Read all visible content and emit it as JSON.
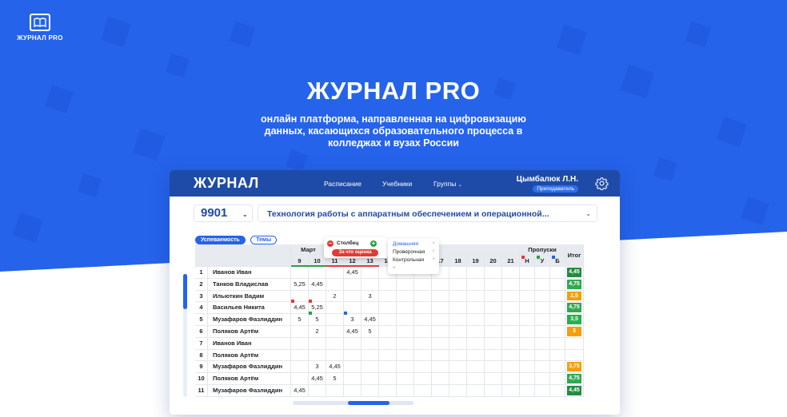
{
  "brand": {
    "logo_text": "ЖУРНАЛ PRO",
    "title": "ЖУРНАЛ PRO",
    "subtitle": "онлайн платформа, направленная на цифровизацию данных, касающихся образовательного процесса в колледжах и вузах России"
  },
  "app": {
    "brand": "ЖУРНАЛ",
    "nav": [
      "Расписание",
      "Учебники",
      "Группы"
    ],
    "user_name": "Цымбалюк Л.Н.",
    "user_role": "Преподаватель",
    "group": "9901",
    "subject": "Технология работы с аппаратным обеспечением и операционной...",
    "tabs": [
      "Успеваемость",
      "Темы"
    ],
    "month": "Март",
    "days": [
      "9",
      "10",
      "11",
      "12",
      "13",
      "14",
      "15",
      "16",
      "17",
      "18",
      "19",
      "20",
      "21"
    ],
    "absences_header": "Пропуски",
    "absence_cols": [
      "Н",
      "У",
      "Б"
    ],
    "itog_header": "Итог",
    "popover": {
      "label": "Столбец",
      "button": "За что оценка"
    },
    "dropdown": [
      "Домашняя",
      "Проверочная",
      "Контрольная",
      "+"
    ],
    "rows": [
      {
        "n": "1",
        "name": "Иванов Иван",
        "marks": [
          "",
          "",
          "",
          "4,45",
          "",
          "",
          "",
          "",
          "",
          "",
          "",
          "",
          ""
        ],
        "itog": "4,45",
        "itog_color": "#1e8e3e"
      },
      {
        "n": "2",
        "name": "Танков Владислав",
        "marks": [
          "5,25",
          "4,45",
          "",
          "",
          "",
          "",
          "",
          "",
          "",
          "",
          "",
          "",
          ""
        ],
        "itog": "4,75",
        "itog_color": "#34a853"
      },
      {
        "n": "3",
        "name": "Ильюткин Вадим",
        "marks": [
          "",
          "",
          "2",
          "",
          "3",
          "",
          "",
          "",
          "",
          "",
          "",
          "",
          ""
        ],
        "itog": "2,5",
        "itog_color": "#f59e0b"
      },
      {
        "n": "4",
        "name": "Васильев Никита",
        "marks": [
          "4,45",
          "5,25",
          "",
          "",
          "",
          "",
          "",
          "",
          "",
          "",
          "",
          "",
          ""
        ],
        "itog": "4,75",
        "itog_color": "#34a853"
      },
      {
        "n": "5",
        "name": "Музафаров Фазлиддин",
        "marks": [
          "5",
          "5",
          "",
          "3",
          "4,45",
          "",
          "",
          "",
          "",
          "",
          "",
          "",
          ""
        ],
        "itog": "3,5",
        "itog_color": "#22b14c"
      },
      {
        "n": "6",
        "name": "Поляков Артём",
        "marks": [
          "",
          "2",
          "",
          "4,45",
          "5",
          "",
          "",
          "",
          "",
          "",
          "",
          "",
          ""
        ],
        "itog": "3",
        "itog_color": "#f59e0b"
      },
      {
        "n": "7",
        "name": "Иванов Иван",
        "marks": [
          "",
          "",
          "",
          "",
          "",
          "",
          "",
          "",
          "",
          "",
          "",
          "",
          ""
        ],
        "itog": "",
        "itog_color": ""
      },
      {
        "n": "8",
        "name": "Поляков Артём",
        "marks": [
          "",
          "",
          "",
          "",
          "",
          "",
          "",
          "",
          "",
          "",
          "",
          "",
          ""
        ],
        "itog": "",
        "itog_color": ""
      },
      {
        "n": "9",
        "name": "Музафаров Фазлиддин",
        "marks": [
          "",
          "3",
          "4,45",
          "",
          "",
          "",
          "",
          "",
          "",
          "",
          "",
          "",
          ""
        ],
        "itog": "3,75",
        "itog_color": "#f59e0b"
      },
      {
        "n": "10",
        "name": "Поляков Артём",
        "marks": [
          "",
          "4,45",
          "5",
          "",
          "",
          "",
          "",
          "",
          "",
          "",
          "",
          "",
          ""
        ],
        "itog": "4,75",
        "itog_color": "#34a853"
      },
      {
        "n": "11",
        "name": "Музафаров Фазлиддин",
        "marks": [
          "4,45",
          "",
          "",
          "",
          "",
          "",
          "",
          "",
          "",
          "",
          "",
          "",
          ""
        ],
        "itog": "4,45",
        "itog_color": "#1e8e3e"
      }
    ]
  },
  "colors": {
    "hero": "#2563eb",
    "nav": "#1e4ba8",
    "accent": "#2563eb"
  }
}
